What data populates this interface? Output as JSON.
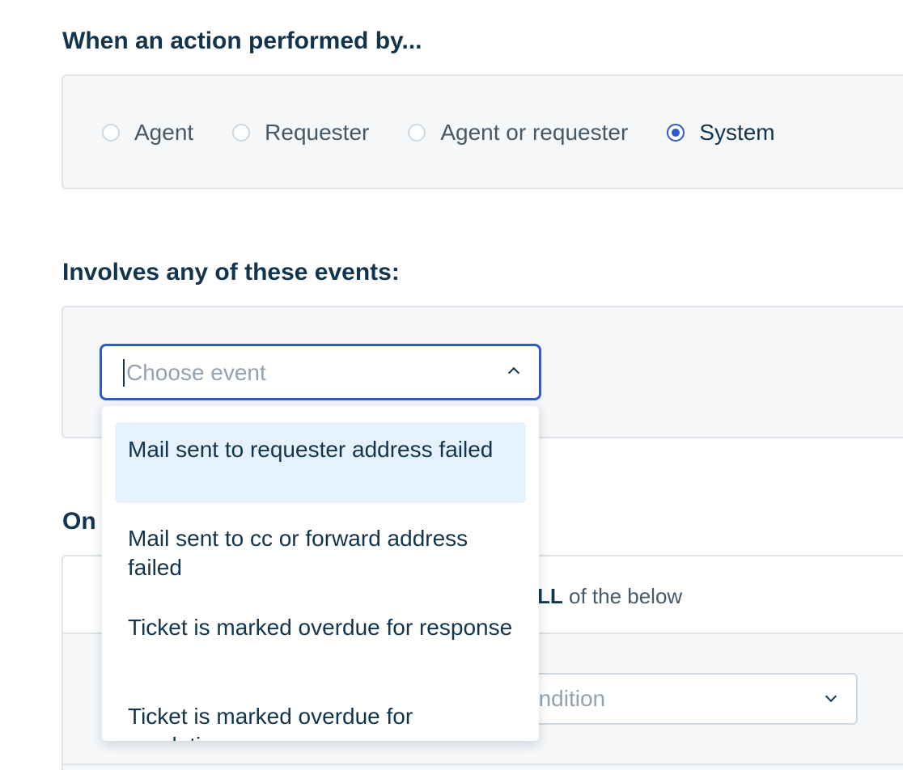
{
  "action_section": {
    "heading": "When an action performed by...",
    "options": [
      {
        "label": "Agent",
        "checked": false
      },
      {
        "label": "Requester",
        "checked": false
      },
      {
        "label": "Agent or requester",
        "checked": false
      },
      {
        "label": "System",
        "checked": true
      }
    ]
  },
  "events_section": {
    "heading": "Involves any of these events:",
    "select": {
      "placeholder": "Choose event",
      "value": ""
    },
    "dropdown_options": [
      "Mail sent to requester address failed",
      "Mail sent to cc or forward address failed",
      "Ticket is marked overdue for response",
      "Ticket is marked overdue for resolution"
    ]
  },
  "conditions_section": {
    "heading_partial": "On",
    "match_keyword_partial": "LL",
    "match_suffix": " of the below",
    "condition_select_partial": "ondition"
  },
  "colors": {
    "accent": "#2c5cc5",
    "text_primary": "#12344d",
    "placeholder": "#92a2b1",
    "panel_bg": "#f5f7f9",
    "highlight_bg": "#e5f2fd"
  }
}
